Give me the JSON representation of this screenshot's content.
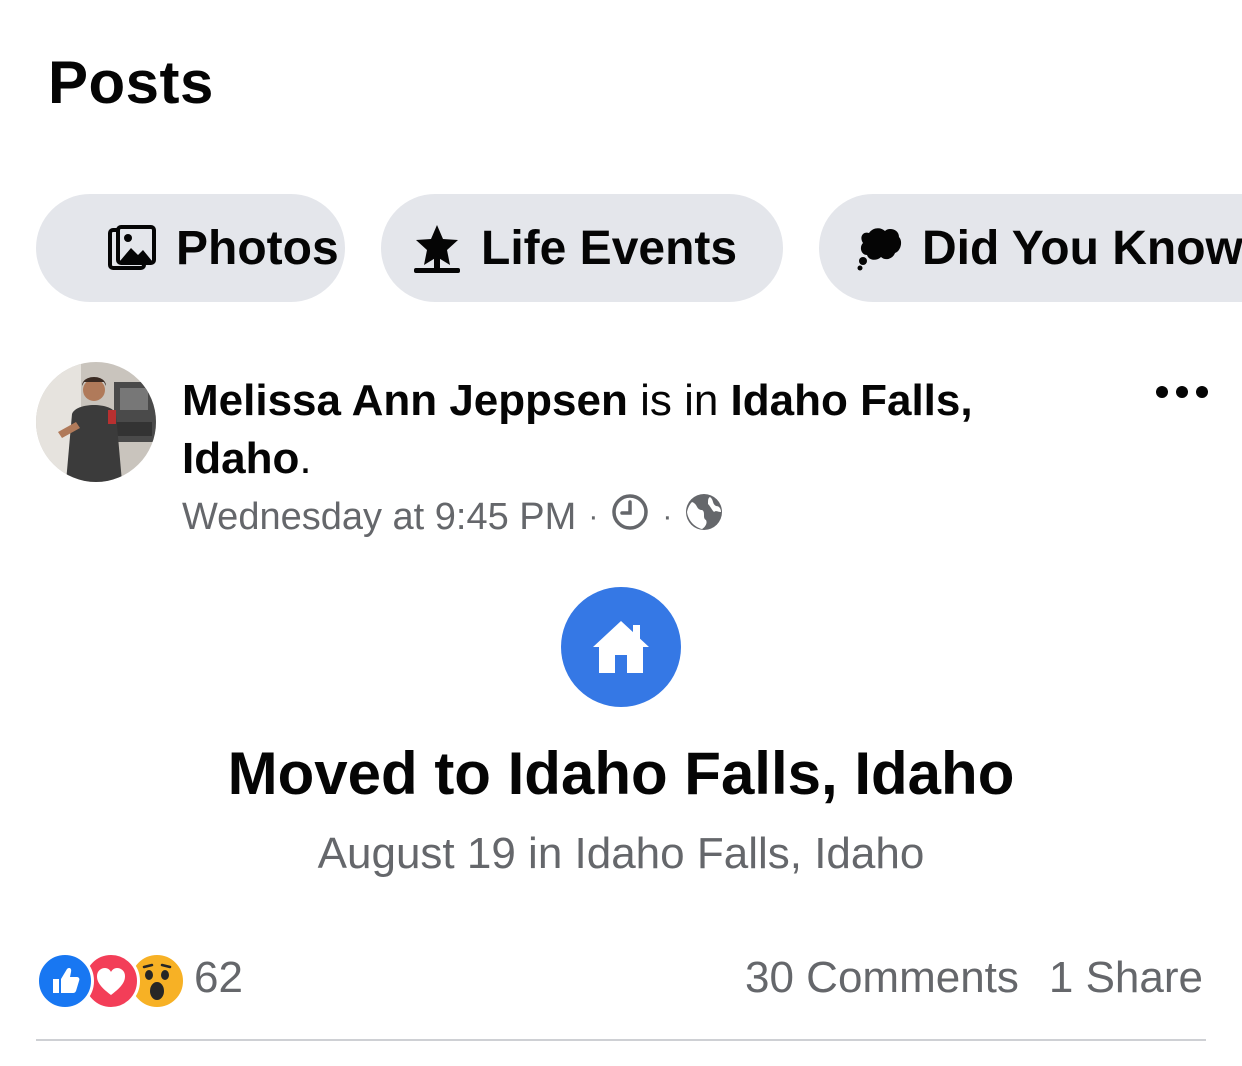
{
  "section": {
    "title": "Posts"
  },
  "filters": [
    {
      "label": "Photos",
      "icon": "photos-icon"
    },
    {
      "label": "Life Events",
      "icon": "star-icon"
    },
    {
      "label": "Did You Know",
      "icon": "speech-bubble-icon"
    }
  ],
  "post": {
    "author": "Melissa Ann Jeppsen",
    "connector": " is in ",
    "place": "Idaho Falls, Idaho",
    "period": ".",
    "timestamp": "Wednesday at 9:45 PM",
    "audience_icon": "globe-icon",
    "clock_icon": "clock-icon",
    "separator": "·"
  },
  "life_event": {
    "icon": "home-icon",
    "title": "Moved to Idaho Falls, Idaho",
    "subtitle": "August 19 in Idaho Falls, Idaho"
  },
  "engagement": {
    "reaction_icons": [
      "like-icon",
      "love-icon",
      "wow-icon"
    ],
    "reaction_count": "62",
    "comments": "30 Comments",
    "shares": "1 Share"
  },
  "colors": {
    "accent_blue": "#3578e5",
    "pill_bg": "#e4e6eb",
    "secondary_text": "#65676b",
    "love_red": "#f33e58",
    "wow_yellow": "#f7b125"
  }
}
